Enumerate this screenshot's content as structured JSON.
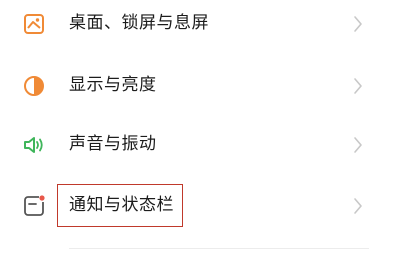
{
  "settings": {
    "items": [
      {
        "label": "桌面、锁屏与息屏",
        "icon": "wallpaper-icon"
      },
      {
        "label": "显示与亮度",
        "icon": "brightness-icon"
      },
      {
        "label": "声音与振动",
        "icon": "speaker-icon"
      },
      {
        "label": "通知与状态栏",
        "icon": "notification-icon",
        "highlighted": true
      }
    ]
  },
  "colors": {
    "accent_orange": "#f08a36",
    "accent_green": "#3fb55b",
    "text": "#1c1c1c",
    "chevron": "#c8c8c8",
    "highlight_border": "#c0392b",
    "notification_dot": "#e8574a"
  }
}
